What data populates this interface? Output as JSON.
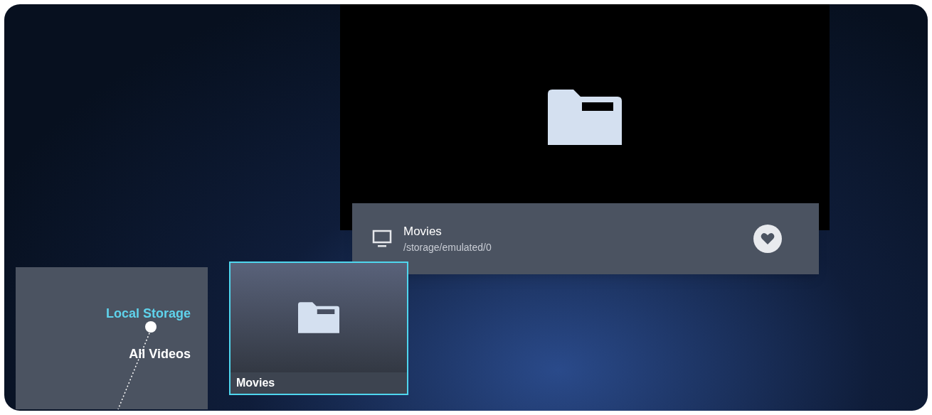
{
  "details": {
    "title": "Movies",
    "path": "/storage/emulated/0"
  },
  "sidebar": {
    "items": [
      {
        "label": "Local Storage",
        "selected": true
      },
      {
        "label": "All Videos",
        "selected": false
      }
    ]
  },
  "tiles": [
    {
      "label": "Movies",
      "selected": true
    }
  ]
}
